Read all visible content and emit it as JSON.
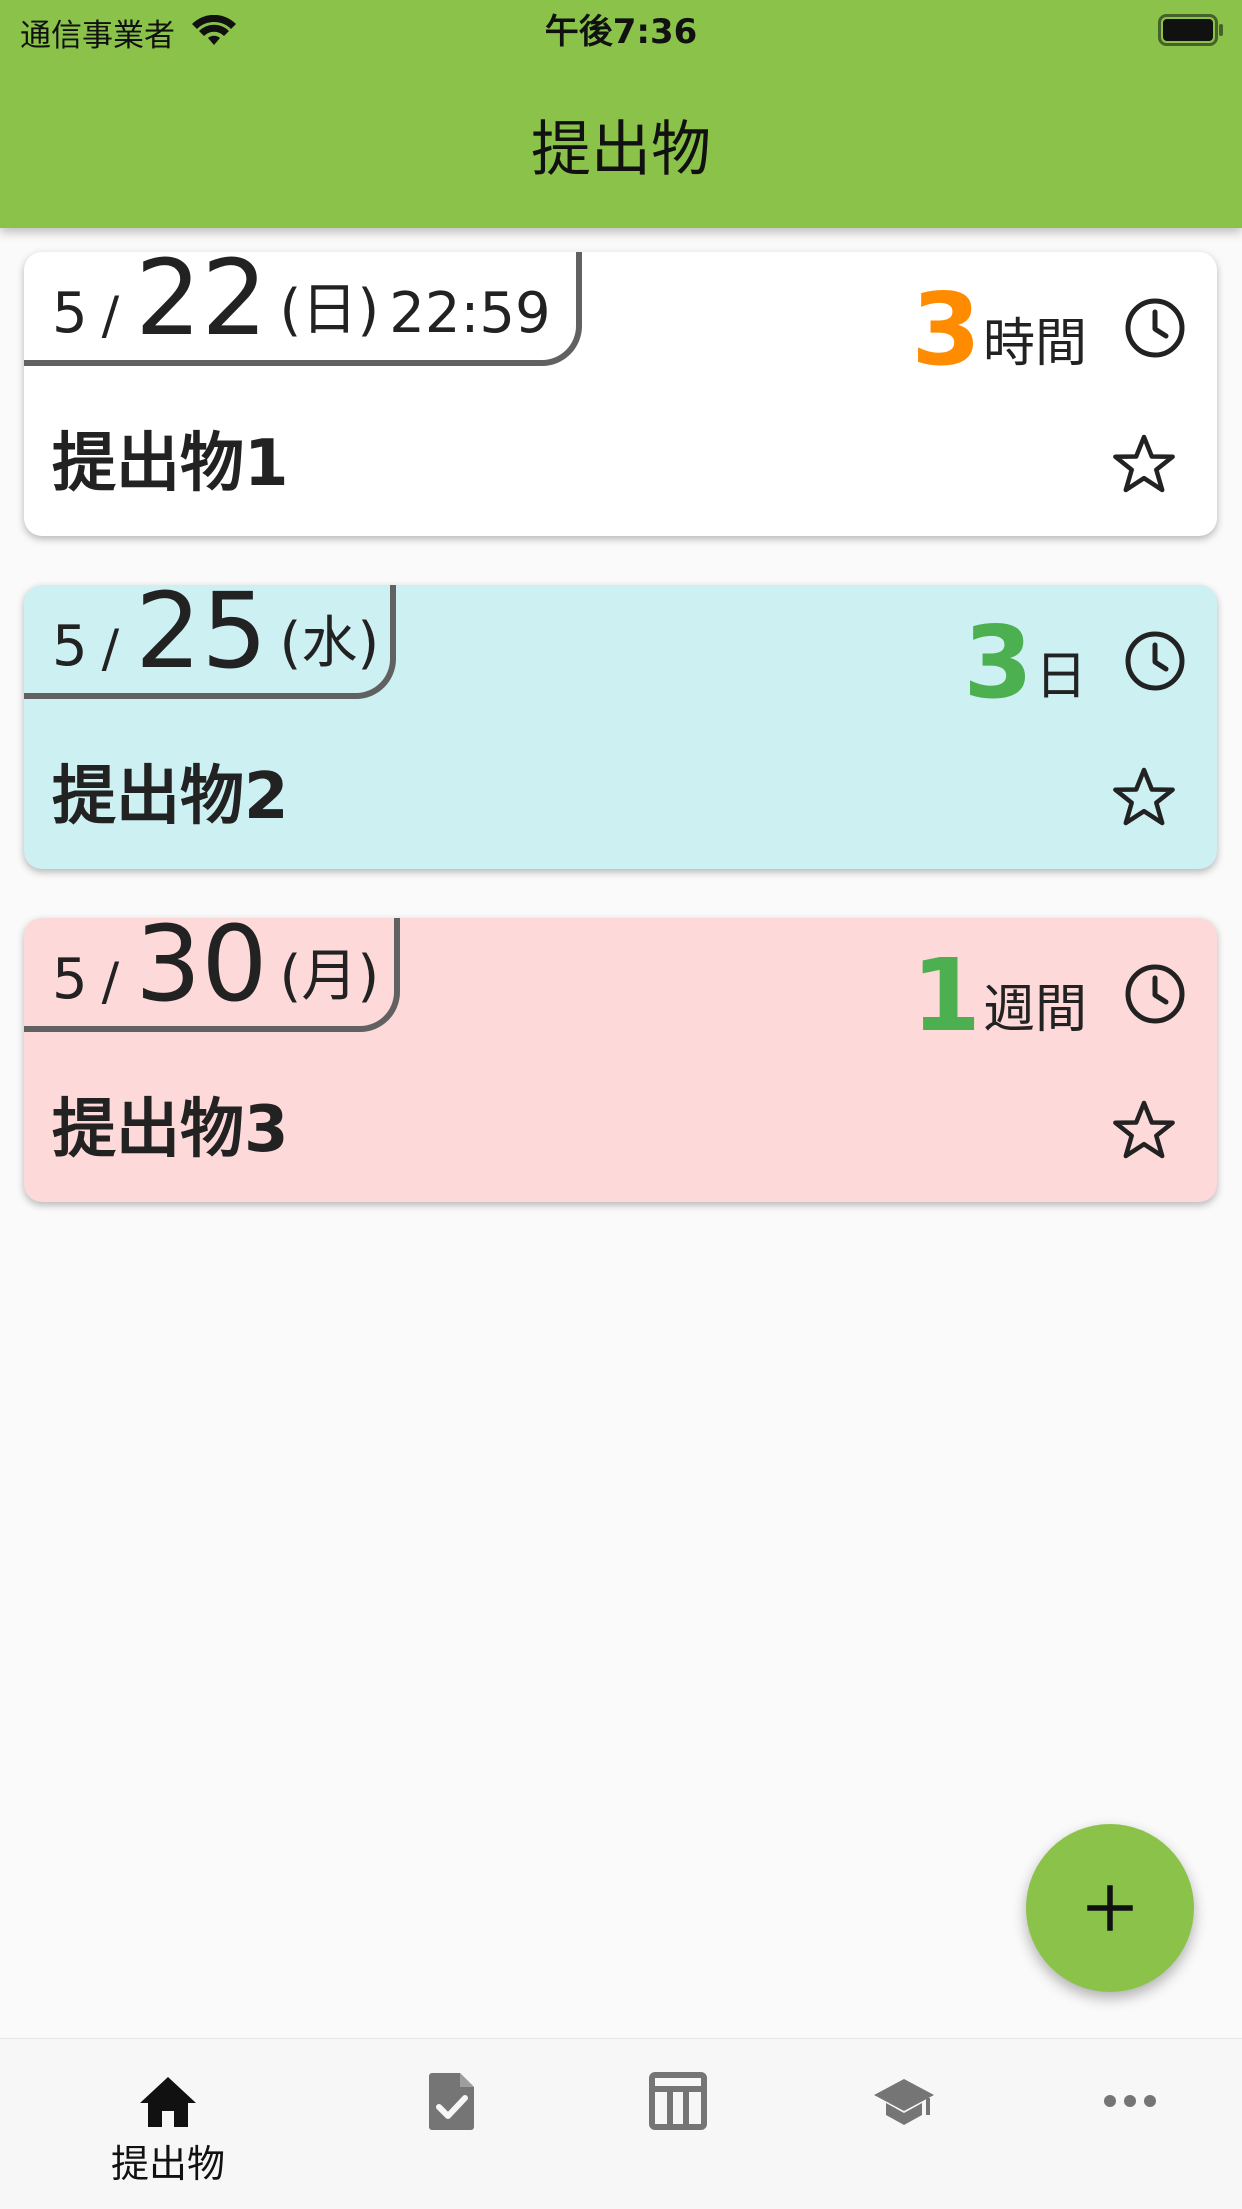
{
  "status_bar": {
    "carrier": "通信事業者",
    "time": "午後7:36"
  },
  "header": {
    "title": "提出物"
  },
  "assignments": [
    {
      "month": "5",
      "slash": "/",
      "day": "22",
      "weekday": "(日)",
      "time": "22:59",
      "remaining_value": "3",
      "remaining_unit": "時間",
      "remaining_color": "#ff8c00",
      "title": "提出物1",
      "background": "#ffffff"
    },
    {
      "month": "5",
      "slash": "/",
      "day": "25",
      "weekday": "(水)",
      "time": "",
      "remaining_value": "3",
      "remaining_unit": "日",
      "remaining_color": "#4caf50",
      "title": "提出物2",
      "background": "#cdf0f3"
    },
    {
      "month": "5",
      "slash": "/",
      "day": "30",
      "weekday": "(月)",
      "time": "",
      "remaining_value": "1",
      "remaining_unit": "週間",
      "remaining_color": "#4caf50",
      "title": "提出物3",
      "background": "#fdd9d9"
    }
  ],
  "fab": {
    "icon": "plus-icon",
    "label": "+"
  },
  "bottom_nav": {
    "items": [
      {
        "icon": "home-icon",
        "label": "提出物",
        "active": true
      },
      {
        "icon": "document-check-icon",
        "label": "",
        "active": false
      },
      {
        "icon": "timetable-icon",
        "label": "",
        "active": false
      },
      {
        "icon": "graduation-cap-icon",
        "label": "",
        "active": false
      },
      {
        "icon": "more-icon",
        "label": "",
        "active": false
      }
    ]
  },
  "colors": {
    "primary": "#8bc34a",
    "accent_orange": "#ff8c00",
    "accent_green": "#4caf50",
    "card_blue": "#cdf0f3",
    "card_pink": "#fdd9d9",
    "inactive_icon": "#757575"
  }
}
